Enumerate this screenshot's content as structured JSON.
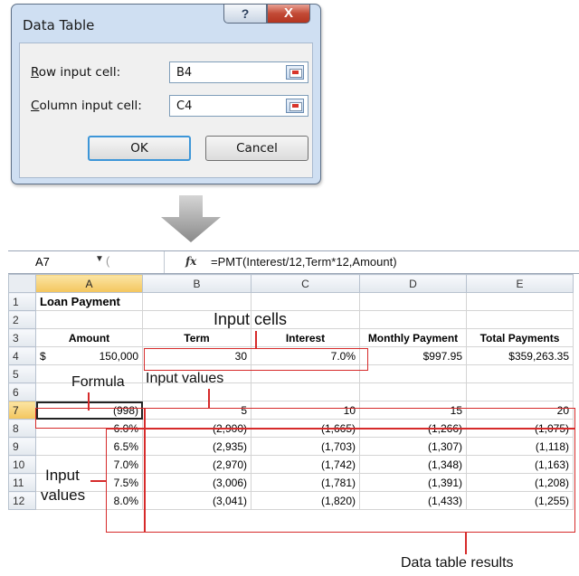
{
  "dialog": {
    "title": "Data Table",
    "help_glyph": "?",
    "close_glyph": "X",
    "row_label_accel": "R",
    "row_label_rest": "ow input cell:",
    "row_value": "B4",
    "col_label_accel": "C",
    "col_label_rest": "olumn input cell:",
    "col_value": "C4",
    "ok": "OK",
    "cancel": "Cancel"
  },
  "formula_bar": {
    "name_box": "A7",
    "fx": "fx",
    "formula": "=PMT(Interest/12,Term*12,Amount)"
  },
  "columns": [
    "A",
    "B",
    "C",
    "D",
    "E"
  ],
  "rows": {
    "r1": {
      "num": "1",
      "a": "Loan Payment"
    },
    "r2": {
      "num": "2"
    },
    "r3": {
      "num": "3",
      "a": "Amount",
      "b": "Term",
      "c": "Interest",
      "d": "Monthly Payment",
      "e": "Total Payments"
    },
    "r4": {
      "num": "4",
      "a_sym": "$",
      "a": "150,000",
      "b": "30",
      "c": "7.0%",
      "d": "$997.95",
      "e": "$359,263.35"
    },
    "r5": {
      "num": "5"
    },
    "r6": {
      "num": "6"
    },
    "r7": {
      "num": "7",
      "a": "(998)",
      "b": "5",
      "c": "10",
      "d": "15",
      "e": "20"
    },
    "r8": {
      "num": "8",
      "a": "6.0%",
      "b": "(2,900)",
      "c": "(1,665)",
      "d": "(1,266)",
      "e": "(1,075)"
    },
    "r9": {
      "num": "9",
      "a": "6.5%",
      "b": "(2,935)",
      "c": "(1,703)",
      "d": "(1,307)",
      "e": "(1,118)"
    },
    "r10": {
      "num": "10",
      "a": "7.0%",
      "b": "(2,970)",
      "c": "(1,742)",
      "d": "(1,348)",
      "e": "(1,163)"
    },
    "r11": {
      "num": "11",
      "a": "7.5%",
      "b": "(3,006)",
      "c": "(1,781)",
      "d": "(1,391)",
      "e": "(1,208)"
    },
    "r12": {
      "num": "12",
      "a": "8.0%",
      "b": "(3,041)",
      "c": "(1,820)",
      "d": "(1,433)",
      "e": "(1,255)"
    }
  },
  "annotations": {
    "input_cells": "Input cells",
    "formula": "Formula",
    "input_values_top": "Input values",
    "input_values_left_1": "Input",
    "input_values_left_2": "values",
    "data_table_results": "Data table results"
  },
  "colors": {
    "annotation_red": "#d62a2a",
    "dialog_frame": "#cfdff2",
    "selected_header": "#f3c55d"
  }
}
